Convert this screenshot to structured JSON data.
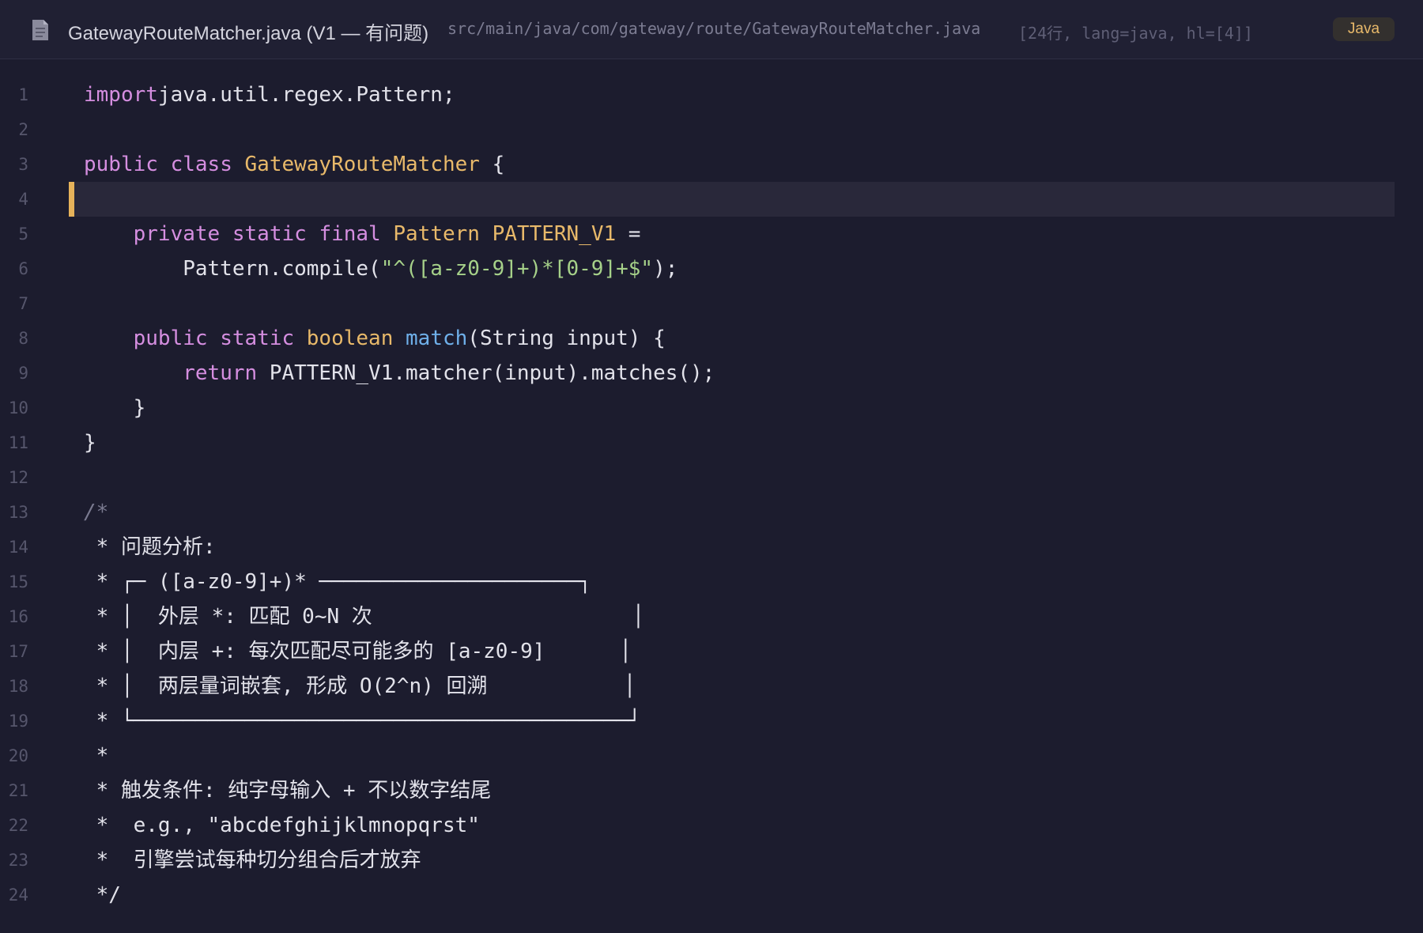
{
  "header": {
    "title": "GatewayRouteMatcher.java (V1 — 有问题)",
    "path": "src/main/java/com/gateway/route/GatewayRouteMatcher.java",
    "meta": "[24行, lang=java, hl=[4]]",
    "language_badge": "Java",
    "file_icon": "document-icon"
  },
  "colors": {
    "background": "#1c1c2e",
    "keyword": "#d58ee0",
    "type": "#e8b96a",
    "function": "#6fb0ea",
    "string": "#a6d189",
    "comment": "#7a7a90",
    "highlight_marker": "#e6b25a"
  },
  "editor": {
    "highlighted_lines": [
      4
    ],
    "lines": [
      {
        "n": "1",
        "t": [
          [
            "kw",
            "import"
          ],
          [
            "",
            "java.util.regex.Pattern;"
          ]
        ]
      },
      {
        "n": "2",
        "t": []
      },
      {
        "n": "3",
        "t": [
          [
            "kw",
            "public"
          ],
          [
            "",
            " "
          ],
          [
            "kw",
            "class"
          ],
          [
            "",
            " "
          ],
          [
            "ty",
            "GatewayRouteMatcher"
          ],
          [
            "",
            " {"
          ]
        ]
      },
      {
        "n": "4",
        "t": []
      },
      {
        "n": "5",
        "t": [
          [
            "",
            "    "
          ],
          [
            "kw",
            "private"
          ],
          [
            "",
            " "
          ],
          [
            "kw",
            "static"
          ],
          [
            "",
            " "
          ],
          [
            "kw",
            "final"
          ],
          [
            "",
            " "
          ],
          [
            "ty",
            "Pattern"
          ],
          [
            "",
            " "
          ],
          [
            "ty",
            "PATTERN_V1"
          ],
          [
            "",
            " ="
          ]
        ]
      },
      {
        "n": "6",
        "t": [
          [
            "",
            "        Pattern.compile("
          ],
          [
            "st",
            "\"^([a-z0-9]+)*[0-9]+$\""
          ],
          [
            "",
            ");"
          ]
        ]
      },
      {
        "n": "7",
        "t": []
      },
      {
        "n": "8",
        "t": [
          [
            "",
            "    "
          ],
          [
            "kw",
            "public"
          ],
          [
            "",
            " "
          ],
          [
            "kw",
            "static"
          ],
          [
            "",
            " "
          ],
          [
            "ty",
            "boolean"
          ],
          [
            "",
            " "
          ],
          [
            "fn",
            "match"
          ],
          [
            "",
            "(String input) {"
          ]
        ]
      },
      {
        "n": "9",
        "t": [
          [
            "",
            "        "
          ],
          [
            "kw",
            "return"
          ],
          [
            "",
            " PATTERN_V1.matcher(input).matches();"
          ]
        ]
      },
      {
        "n": "10",
        "t": [
          [
            "",
            "    }"
          ]
        ]
      },
      {
        "n": "11",
        "t": [
          [
            "",
            "}"
          ]
        ]
      },
      {
        "n": "12",
        "t": []
      },
      {
        "n": "13",
        "t": [
          [
            "cm",
            "/*"
          ]
        ]
      },
      {
        "n": "14",
        "t": [
          [
            "cb",
            " * 问题分析:"
          ]
        ]
      },
      {
        "n": "15",
        "t": [
          [
            "cb",
            " * ┌─ ([a-z0-9]+)* ─────────────────────┐"
          ]
        ]
      },
      {
        "n": "16",
        "t": [
          [
            "cb",
            " * │  外层 *: 匹配 0~N 次                     │"
          ]
        ]
      },
      {
        "n": "17",
        "t": [
          [
            "cb",
            " * │  内层 +: 每次匹配尽可能多的 [a-z0-9]      │"
          ]
        ]
      },
      {
        "n": "18",
        "t": [
          [
            "cb",
            " * │  两层量词嵌套, 形成 O(2^n) 回溯           │"
          ]
        ]
      },
      {
        "n": "19",
        "t": [
          [
            "cb",
            " * └────────────────────────────────────────┘"
          ]
        ]
      },
      {
        "n": "20",
        "t": [
          [
            "cb",
            " *"
          ]
        ]
      },
      {
        "n": "21",
        "t": [
          [
            "cb",
            " * 触发条件: 纯字母输入 + 不以数字结尾"
          ]
        ]
      },
      {
        "n": "22",
        "t": [
          [
            "cb",
            " *  e.g., \"abcdefghijklmnopqrst\""
          ]
        ]
      },
      {
        "n": "23",
        "t": [
          [
            "cb",
            " *  引擎尝试每种切分组合后才放弃"
          ]
        ]
      },
      {
        "n": "24",
        "t": [
          [
            "cb",
            " */"
          ]
        ]
      }
    ]
  }
}
